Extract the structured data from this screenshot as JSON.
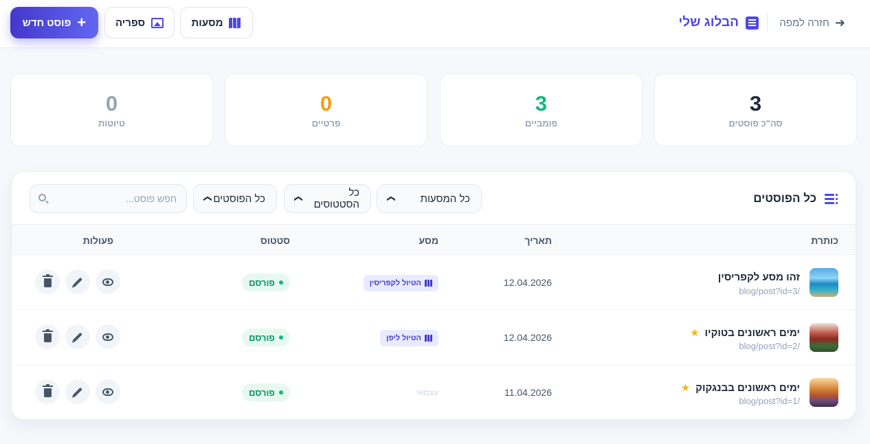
{
  "header": {
    "back_label": "חזרה למפה",
    "brand_title": "הבלוג שלי",
    "trips_label": "מסעות",
    "gallery_label": "ספריה",
    "new_post_label": "פוסט חדש"
  },
  "stats": [
    {
      "value": "3",
      "label": "סה\"כ פוסטים",
      "color": "#1e293b"
    },
    {
      "value": "3",
      "label": "פומביים",
      "color": "#10b981"
    },
    {
      "value": "0",
      "label": "פרטיים",
      "color": "#f59e0b"
    },
    {
      "value": "0",
      "label": "טיוטות",
      "color": "#94a3b8"
    }
  ],
  "posts_card": {
    "title": "כל הפוסטים",
    "filters": {
      "trip": "כל המסעות",
      "status": "כל הסטטוסים",
      "visibility": "כל הפוסטים"
    },
    "search_placeholder": "חפש פוסט...",
    "columns": {
      "title": "כותרת",
      "date": "תאריך",
      "trip": "מסע",
      "status": "סטטוס",
      "actions": "פעולות"
    },
    "rows": [
      {
        "title": "זהו מסע לקפריסין",
        "url": "/blog/post?id=3",
        "date": "12.04.2026",
        "trip": "הטיול לקפריסין",
        "status": "פורסם",
        "featured": false,
        "thumb": "sea"
      },
      {
        "title": "ימים ראשונים בטוקיו",
        "url": "/blog/post?id=2",
        "date": "12.04.2026",
        "trip": "הטיול ליפן",
        "status": "פורסם",
        "featured": true,
        "thumb": "tokyo"
      },
      {
        "title": "ימים ראשונים בבנגקוק",
        "url": "/blog/post?id=1",
        "date": "11.04.2026",
        "trip": "עצמאי",
        "status": "פורסם",
        "featured": true,
        "thumb": "bangkok"
      }
    ]
  },
  "colors": {
    "accent": "#4f46e5",
    "published": "#10b981",
    "star": "#f5b50b"
  }
}
